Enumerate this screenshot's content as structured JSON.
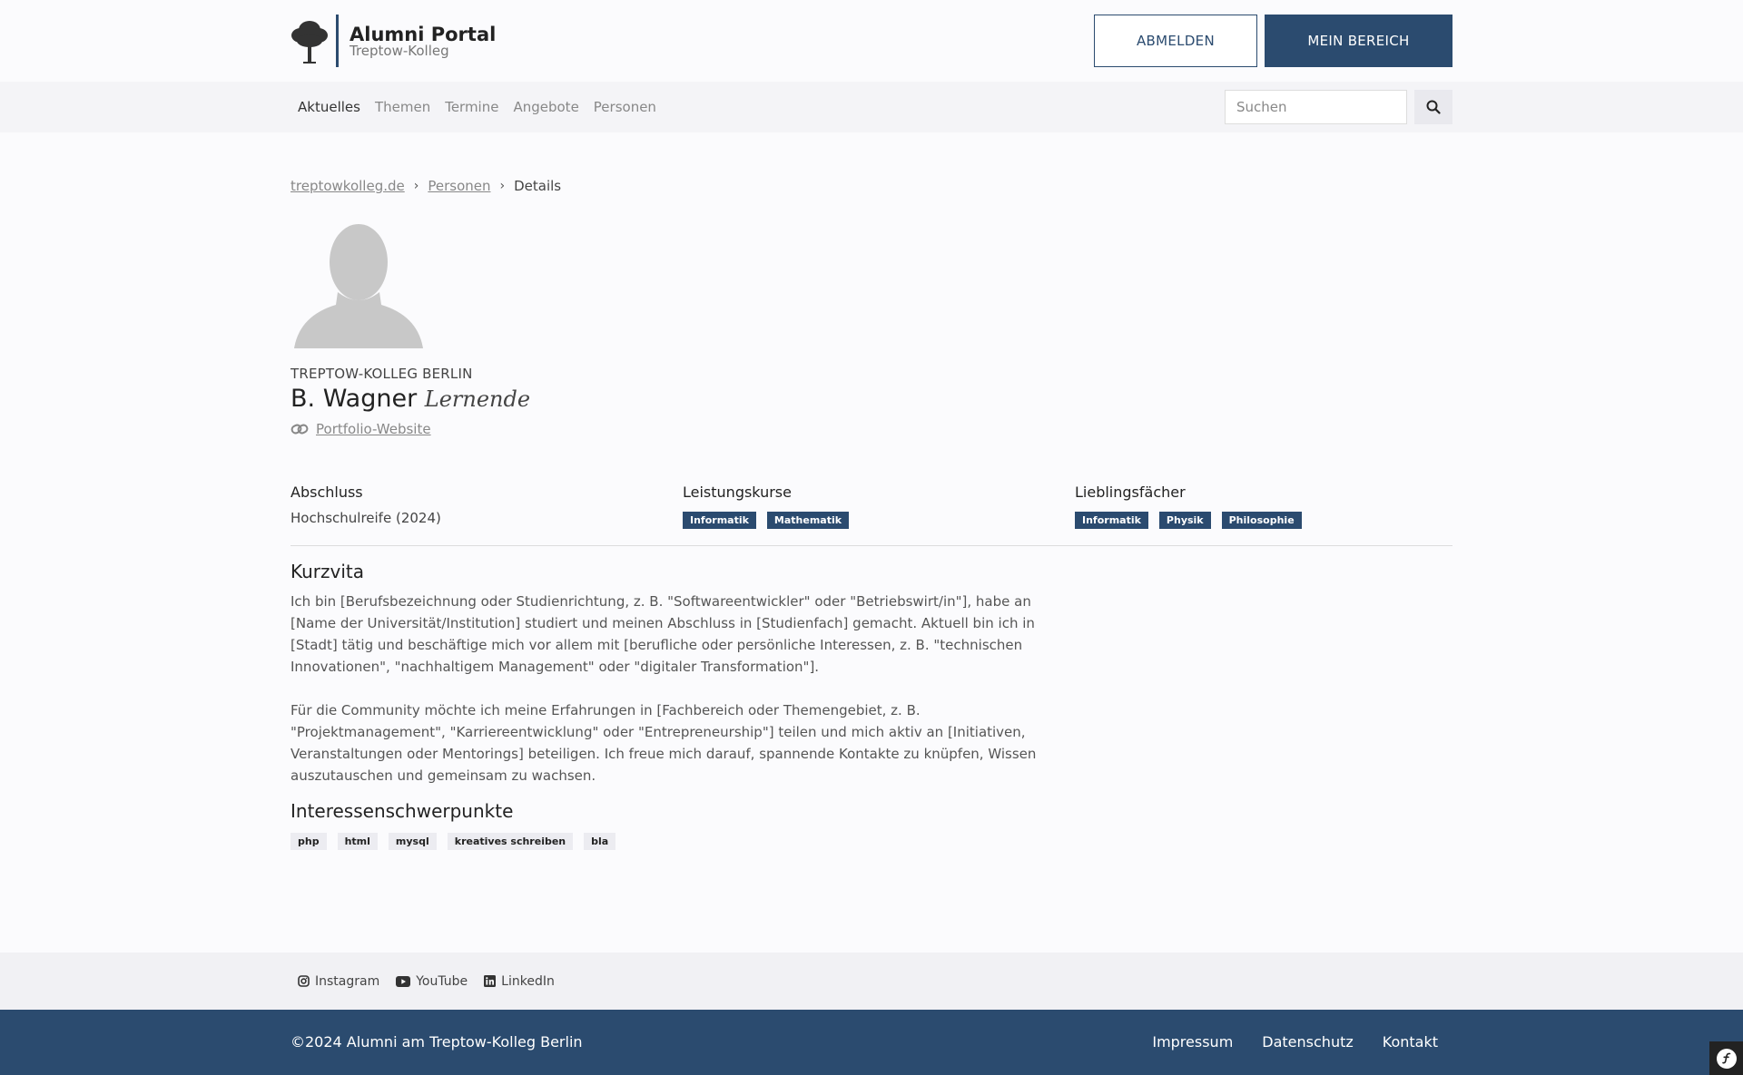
{
  "header": {
    "logo_title": "Alumni Portal",
    "logo_subtitle": "Treptow-Kolleg",
    "logout_label": "ABMELDEN",
    "my_area_label": "MEIN BEREICH"
  },
  "nav": {
    "items": [
      "Aktuelles",
      "Themen",
      "Termine",
      "Angebote",
      "Personen"
    ],
    "active": "Aktuelles",
    "search_placeholder": "Suchen"
  },
  "breadcrumb": {
    "home": "treptowkolleg.de",
    "section": "Personen",
    "current": "Details"
  },
  "profile": {
    "organization": "TREPTOW-KOLLEG BERLIN",
    "name": "B. Wagner",
    "role": "Lernende",
    "portfolio_label": "Portfolio-Website"
  },
  "details": {
    "degree_heading": "Abschluss",
    "degree_value": "Hochschulreife (2024)",
    "courses_heading": "Leistungskurse",
    "courses": [
      "Informatik",
      "Mathematik"
    ],
    "favorites_heading": "Lieblingsfächer",
    "favorites": [
      "Informatik",
      "Physik",
      "Philosophie"
    ]
  },
  "bio": {
    "heading": "Kurzvita",
    "paragraph1": "Ich bin [Berufsbezeichnung oder Studienrichtung, z. B. \"Softwareentwickler\" oder \"Betriebswirt/in\"], habe an [Name der Universität/Institution] studiert und meinen Abschluss in [Studienfach] gemacht. Aktuell bin ich in [Stadt] tätig und beschäftige mich vor allem mit [berufliche oder persönliche Interessen, z. B. \"technischen Innovationen\", \"nachhaltigem Management\" oder \"digitaler Transformation\"].",
    "paragraph2": "Für die Community möchte ich meine Erfahrungen in [Fachbereich oder Themengebiet, z. B. \"Projektmanagement\", \"Karriereentwicklung\" oder \"Entrepreneurship\"] teilen und mich aktiv an [Initiativen, Veranstaltungen oder Mentorings] beteiligen. Ich freue mich darauf, spannende Kontakte zu knüpfen, Wissen auszutauschen und gemeinsam zu wachsen."
  },
  "interests": {
    "heading": "Interessenschwerpunkte",
    "tags": [
      "php",
      "html",
      "mysql",
      "kreatives schreiben",
      "bla"
    ]
  },
  "social": {
    "instagram": "Instagram",
    "youtube": "YouTube",
    "linkedin": "LinkedIn"
  },
  "footer": {
    "copyright": "©2024 Alumni am Treptow-Kolleg Berlin",
    "links": [
      "Impressum",
      "Datenschutz",
      "Kontakt"
    ]
  },
  "colors": {
    "primary": "#2b4b6f",
    "background": "#fbfbfd"
  }
}
